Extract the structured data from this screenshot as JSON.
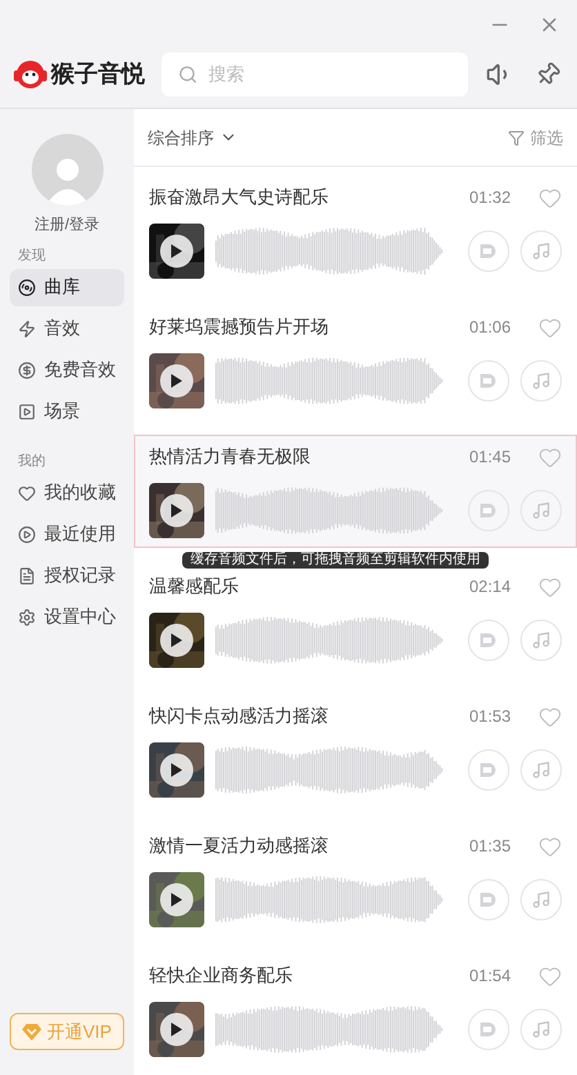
{
  "app": {
    "name": "猴子音悦"
  },
  "search": {
    "placeholder": "搜索"
  },
  "user": {
    "login": "注册/登录"
  },
  "sidebar": {
    "sections": [
      {
        "title": "发现",
        "items": [
          {
            "label": "曲库",
            "selected": true
          },
          {
            "label": "音效",
            "selected": false
          },
          {
            "label": "免费音效",
            "selected": false
          },
          {
            "label": "场景",
            "selected": false
          }
        ]
      },
      {
        "title": "我的",
        "items": [
          {
            "label": "我的收藏",
            "selected": false
          },
          {
            "label": "最近使用",
            "selected": false
          },
          {
            "label": "授权记录",
            "selected": false
          },
          {
            "label": "设置中心",
            "selected": false
          }
        ]
      }
    ]
  },
  "vip_button": "开通VIP",
  "sort": "综合排序",
  "filter": "筛选",
  "tracks": [
    {
      "title": "振奋激昂大气史诗配乐",
      "duration": "01:32",
      "selected": false
    },
    {
      "title": "好莱坞震撼预告片开场",
      "duration": "01:06",
      "selected": false
    },
    {
      "title": "热情活力青春无极限",
      "duration": "01:45",
      "selected": true
    },
    {
      "title": "温馨感配乐",
      "duration": "02:14",
      "selected": false
    },
    {
      "title": "快闪卡点动感活力摇滚",
      "duration": "01:53",
      "selected": false
    },
    {
      "title": "激情一夏活力动感摇滚",
      "duration": "01:35",
      "selected": false
    },
    {
      "title": "轻快企业商务配乐",
      "duration": "01:54",
      "selected": false
    }
  ],
  "tooltip": "缓存音频文件后，可拖拽音频至剪辑软件内使用"
}
